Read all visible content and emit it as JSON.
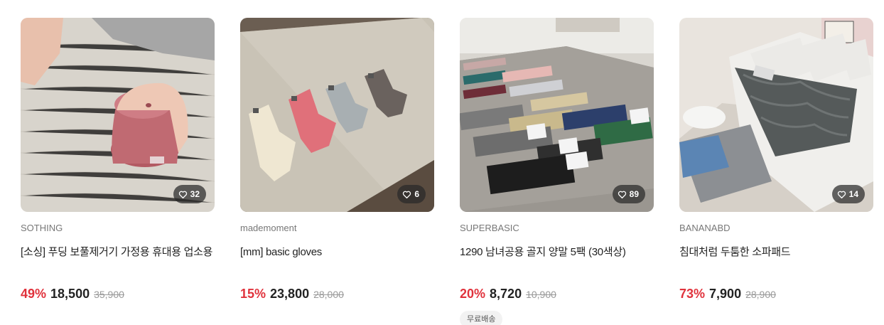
{
  "products": [
    {
      "brand": "SOTHING",
      "title": "[소싱] 푸딩 보풀제거기 가정용 휴대용 업소용",
      "likes": "32",
      "discount": "49%",
      "sale_price": "18,500",
      "original_price": "35,900",
      "tag": ""
    },
    {
      "brand": "mademoment",
      "title": "[mm] basic gloves",
      "likes": "6",
      "discount": "15%",
      "sale_price": "23,800",
      "original_price": "28,000",
      "tag": ""
    },
    {
      "brand": "SUPERBASIC",
      "title": "1290 남녀공용 골지 양말 5팩 (30색상)",
      "likes": "89",
      "discount": "20%",
      "sale_price": "8,720",
      "original_price": "10,900",
      "tag": "무료배송"
    },
    {
      "brand": "BANANABD",
      "title": "침대처럼 두툼한 소파패드",
      "likes": "14",
      "discount": "73%",
      "sale_price": "7,900",
      "original_price": "28,900",
      "tag": ""
    }
  ],
  "colors": {
    "discount": "#e0323c",
    "like_badge": "#282828",
    "tag_bg": "#f2f2f2"
  },
  "icons": {
    "like": "heart-outline-icon"
  }
}
